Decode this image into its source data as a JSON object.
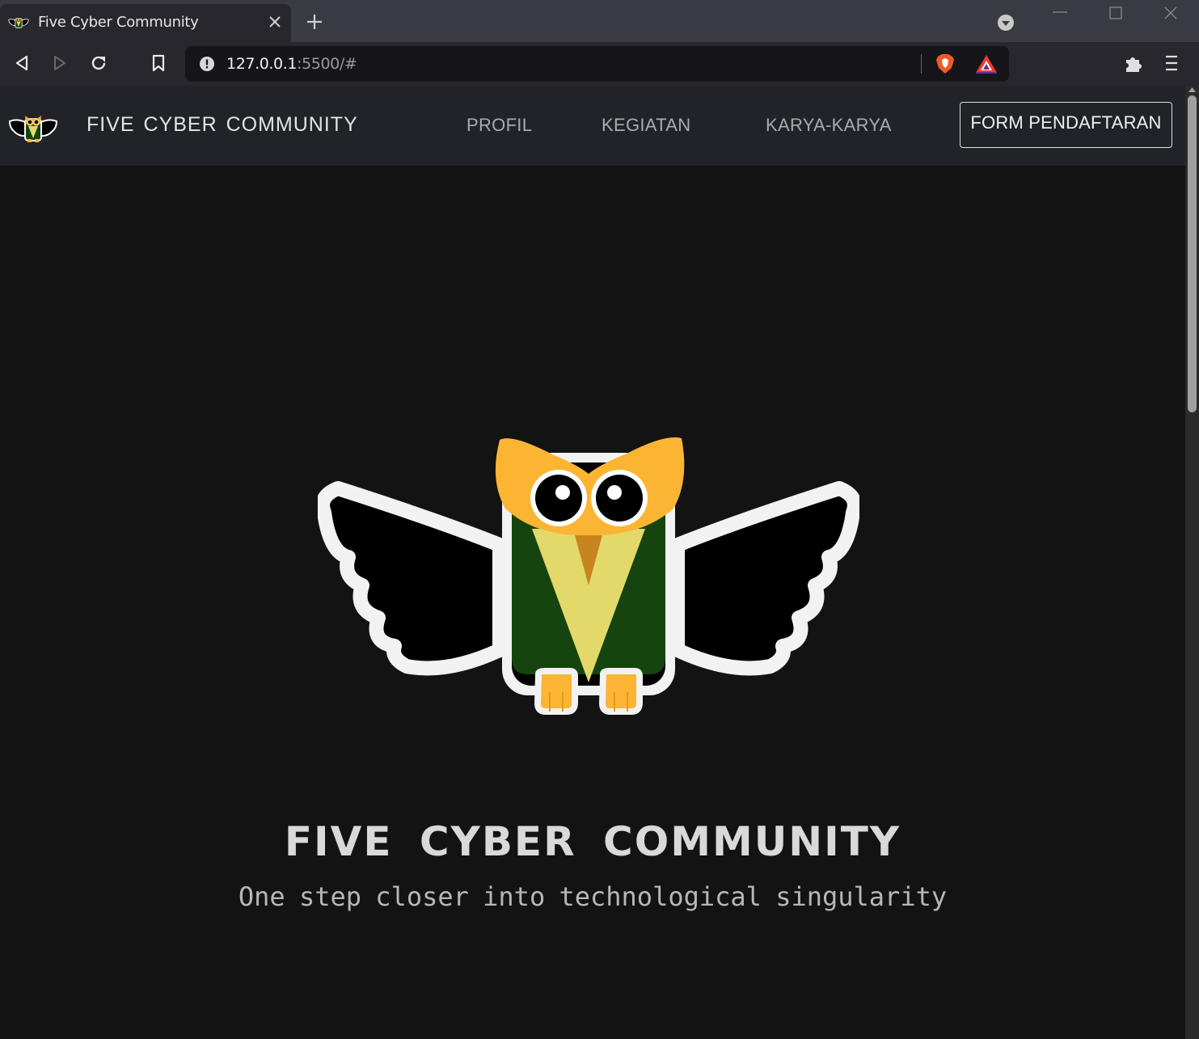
{
  "browser": {
    "tab_title": "Five Cyber Community",
    "url_host": "127.0.0.1",
    "url_rest": ":5500/#"
  },
  "navbar": {
    "brand": "FIVE CYBER COMMUNITY",
    "links": [
      "PROFIL",
      "KEGIATAN",
      "KARYA-KARYA"
    ],
    "cta": "FORM PENDAFTARAN"
  },
  "hero": {
    "title": "FIVE CYBER COMMUNITY",
    "tagline": "One step closer into technological singularity"
  },
  "colors": {
    "page_bg": "#131313",
    "navbar_bg": "#212328",
    "owl_orange": "#fbb533",
    "owl_green": "#16440f",
    "owl_vest": "#e3d96a",
    "owl_beak": "#c7851f"
  },
  "icons": [
    "owl-logo",
    "close-icon",
    "plus-icon",
    "chevron-down-icon",
    "back-icon",
    "forward-icon",
    "reload-icon",
    "bookmark-icon",
    "info-icon",
    "brave-shield-icon",
    "brave-rewards-icon",
    "extensions-icon",
    "menu-icon"
  ]
}
